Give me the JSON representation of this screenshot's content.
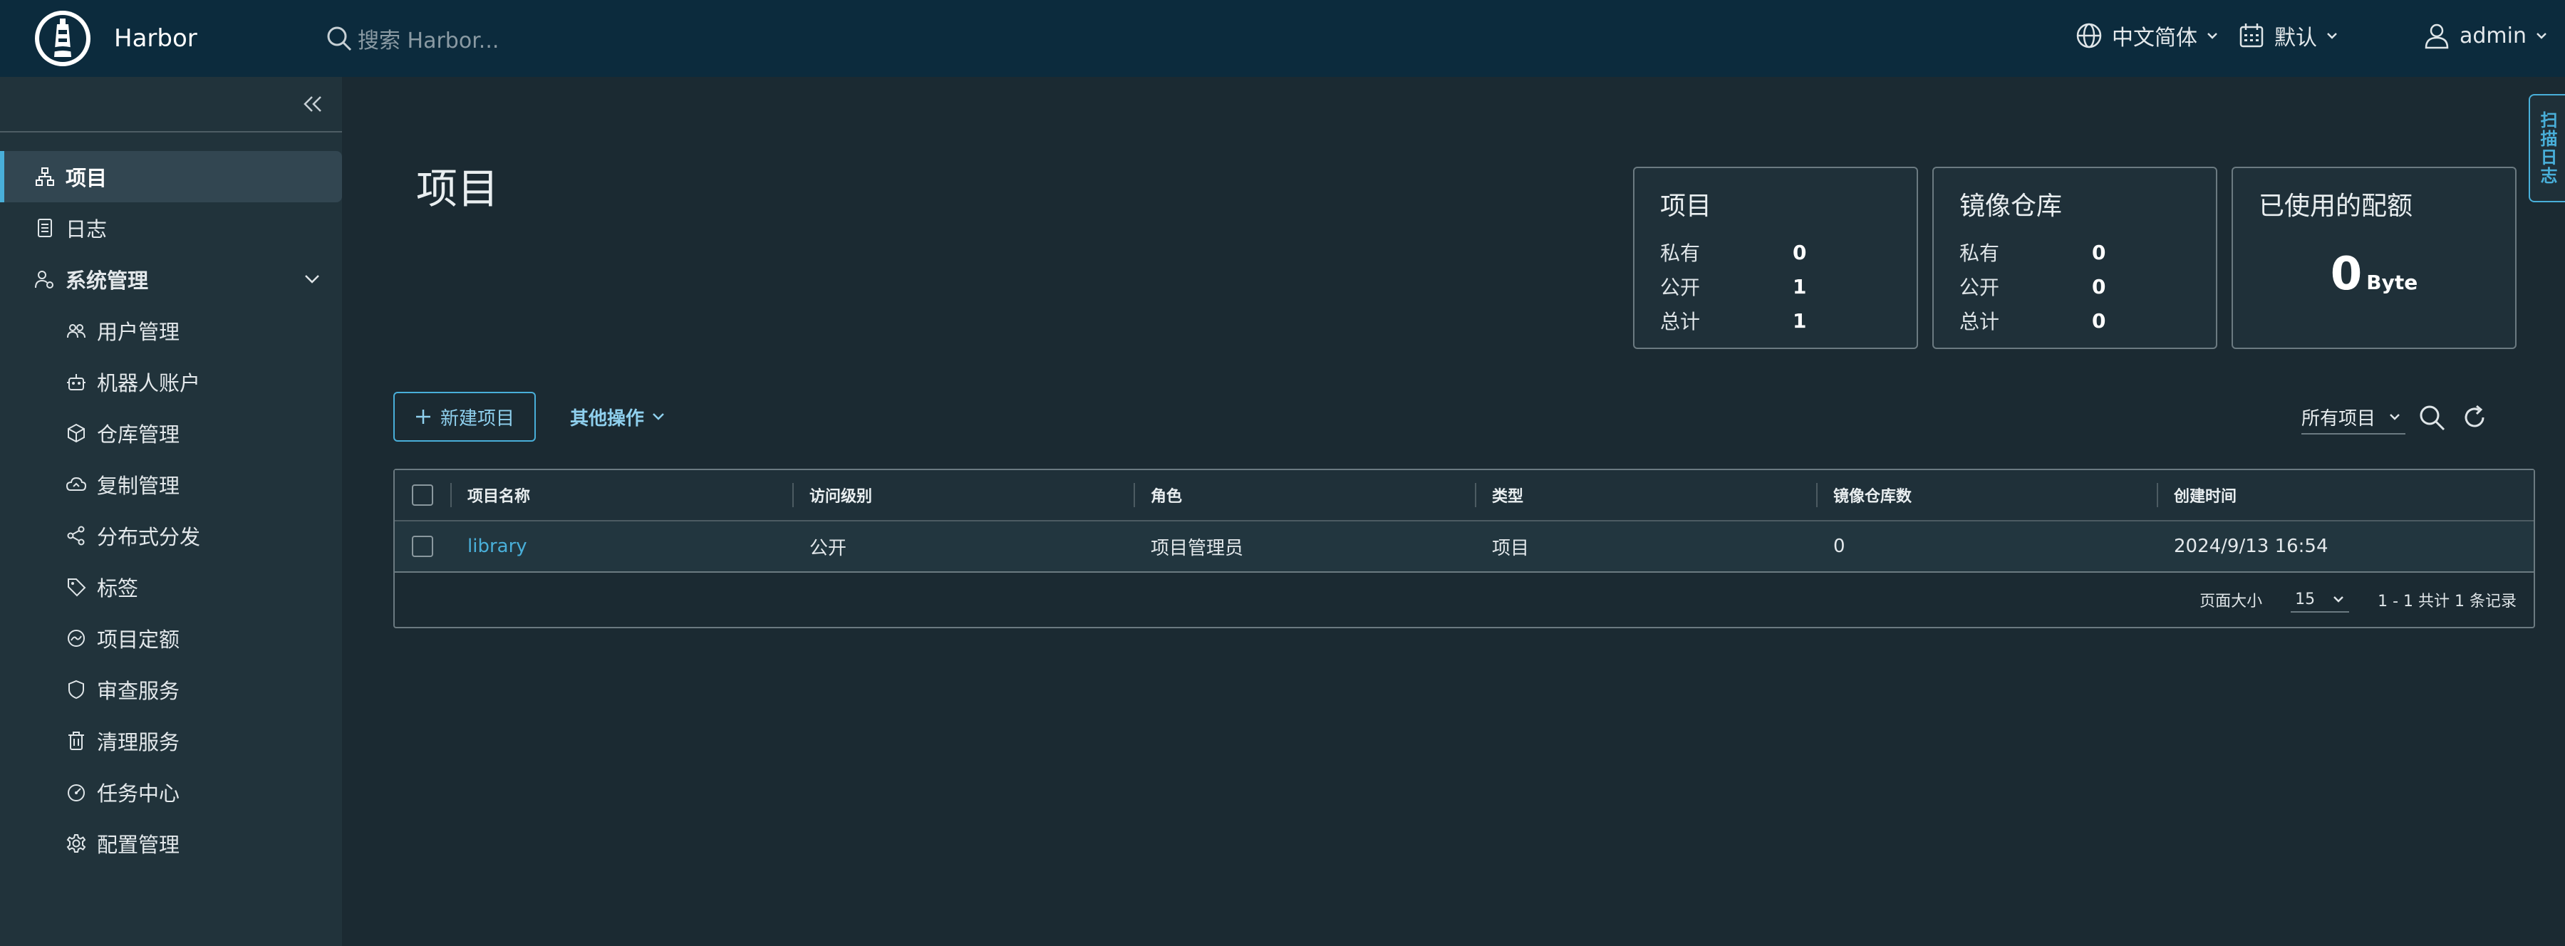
{
  "header": {
    "app_name": "Harbor",
    "search_placeholder": "搜索 Harbor...",
    "language": "中文简体",
    "schedule": "默认",
    "user": "admin"
  },
  "sidebar": {
    "items": [
      {
        "label": "项目",
        "icon": "projects-icon",
        "active": true
      },
      {
        "label": "日志",
        "icon": "logs-icon"
      },
      {
        "label": "系统管理",
        "icon": "admin-icon",
        "expanded": true
      }
    ],
    "sub_items": [
      {
        "label": "用户管理",
        "icon": "users-icon"
      },
      {
        "label": "机器人账户",
        "icon": "robot-icon"
      },
      {
        "label": "仓库管理",
        "icon": "registry-icon"
      },
      {
        "label": "复制管理",
        "icon": "replication-icon"
      },
      {
        "label": "分布式分发",
        "icon": "share-icon"
      },
      {
        "label": "标签",
        "icon": "tag-icon"
      },
      {
        "label": "项目定额",
        "icon": "quota-icon"
      },
      {
        "label": "审查服务",
        "icon": "shield-icon"
      },
      {
        "label": "清理服务",
        "icon": "trash-icon"
      },
      {
        "label": "任务中心",
        "icon": "dashboard-icon"
      },
      {
        "label": "配置管理",
        "icon": "gear-icon"
      }
    ]
  },
  "main": {
    "page_title": "项目",
    "cards": {
      "projects": {
        "title": "项目",
        "rows": [
          {
            "k": "私有",
            "v": "0"
          },
          {
            "k": "公开",
            "v": "1"
          },
          {
            "k": "总计",
            "v": "1"
          }
        ]
      },
      "repositories": {
        "title": "镜像仓库",
        "rows": [
          {
            "k": "私有",
            "v": "0"
          },
          {
            "k": "公开",
            "v": "0"
          },
          {
            "k": "总计",
            "v": "0"
          }
        ]
      },
      "quota": {
        "title": "已使用的配额",
        "value": "0",
        "unit": "Byte"
      }
    },
    "actions": {
      "new_project": "新建项目",
      "other_actions": "其他操作"
    },
    "filter": {
      "selected": "所有项目"
    },
    "table": {
      "columns": [
        "项目名称",
        "访问级别",
        "角色",
        "类型",
        "镜像仓库数",
        "创建时间"
      ],
      "rows": [
        {
          "name": "library",
          "access": "公开",
          "role": "项目管理员",
          "type": "项目",
          "repo_count": "0",
          "created": "2024/9/13 16:54"
        }
      ],
      "footer": {
        "page_size_label": "页面大小",
        "page_size": "15",
        "summary": "1 - 1 共计 1 条记录"
      }
    },
    "side_tab": "扫描日志"
  },
  "colors": {
    "accent": "#49afd9",
    "header_bg": "#0c2b3d",
    "sidebar_bg": "#21333b",
    "content_bg": "#1b2a32"
  }
}
